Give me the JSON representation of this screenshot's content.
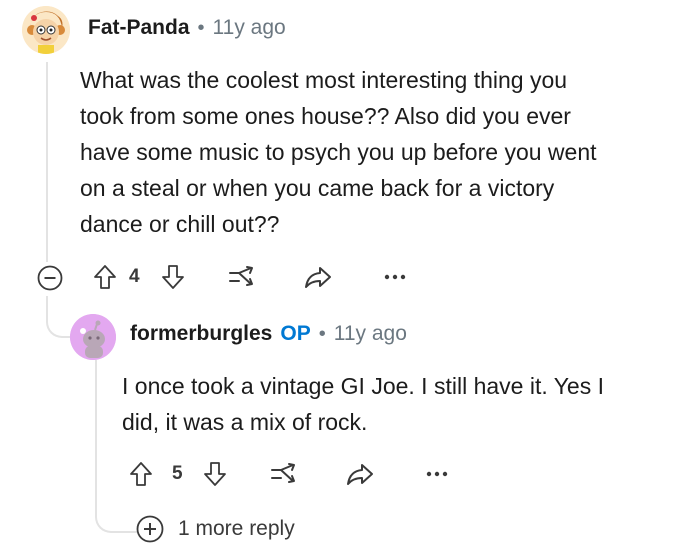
{
  "comment": {
    "username": "Fat-Panda",
    "separator": "•",
    "time": "11y ago",
    "body": [
      "What was the coolest most interesting thing you",
      "took from some ones house?? Also did you ever",
      "have some music to psych you up before you went",
      "on a steal or when you came back for a victory",
      "dance or chill out??"
    ],
    "votes": "4",
    "avatar_icon": "cartoon-avatar-icon"
  },
  "reply": {
    "username": "formerburgles",
    "op_badge": "OP",
    "separator": "•",
    "time": "11y ago",
    "body": [
      "I once took a vintage GI Joe. I still have it. Yes I",
      "did, it was a mix of rock."
    ],
    "votes": "5",
    "avatar_icon": "snoo-avatar-icon"
  },
  "more_replies": {
    "label": "1 more reply"
  },
  "colors": {
    "accent": "#0079d3",
    "text": "#1c1c1c",
    "muted": "#6b7780",
    "line": "#e3e3e3",
    "reply_avatar_bg": "#e3a8f0"
  }
}
